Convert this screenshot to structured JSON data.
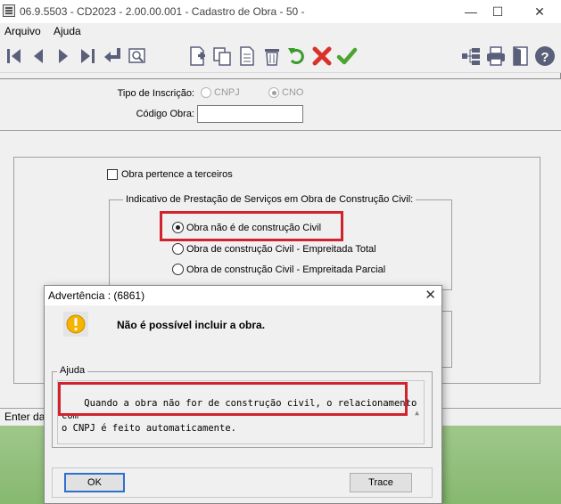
{
  "window": {
    "title": "06.9.5503 - CD2023 - 2.00.00.001 - Cadastro de Obra - 50 -",
    "minimize": "—",
    "maximize": "☐",
    "close": "✕"
  },
  "menu": {
    "items": [
      "Arquivo",
      "Ajuda"
    ]
  },
  "toolbar": {
    "buttons": [
      "first-icon",
      "previous-icon",
      "next-icon",
      "last-icon",
      "return-icon",
      "search-icon",
      "new-icon",
      "copy-icon",
      "edit-icon",
      "delete-icon",
      "undo-icon",
      "cancel-icon",
      "confirm-icon",
      "tree-icon",
      "print-icon",
      "exit-icon",
      "help-icon"
    ]
  },
  "form": {
    "tipo_inscricao_label": "Tipo de Inscrição:",
    "cnpj_label": "CNPJ",
    "cno_label": "CNO",
    "codigo_obra_label": "Código Obra:",
    "codigo_obra_value": "",
    "terceiros_label": "Obra pertence a terceiros",
    "indicativo_legend": "Indicativo de Prestação de Serviços em Obra de Construção Civil:",
    "options": [
      "Obra não é de construção Civil",
      "Obra de construção Civil - Empreitada Total",
      "Obra de construção Civil - Empreitada Parcial"
    ],
    "selected_option": 0
  },
  "statusbar": {
    "text": "Enter da"
  },
  "dialog": {
    "title": "Advertência : (6861)",
    "close": "✕",
    "message": "Não é possível incluir a obra.",
    "help_legend": "Ajuda",
    "help_text": "Quando a obra não for de construção civil, o relacionamento com\no CNPJ é feito automaticamente.",
    "ok_label": "OK",
    "trace_label": "Trace"
  },
  "colors": {
    "highlight": "#d0232d",
    "default_button_border": "#2f6fcf",
    "warning_yellow": "#f4b400"
  }
}
